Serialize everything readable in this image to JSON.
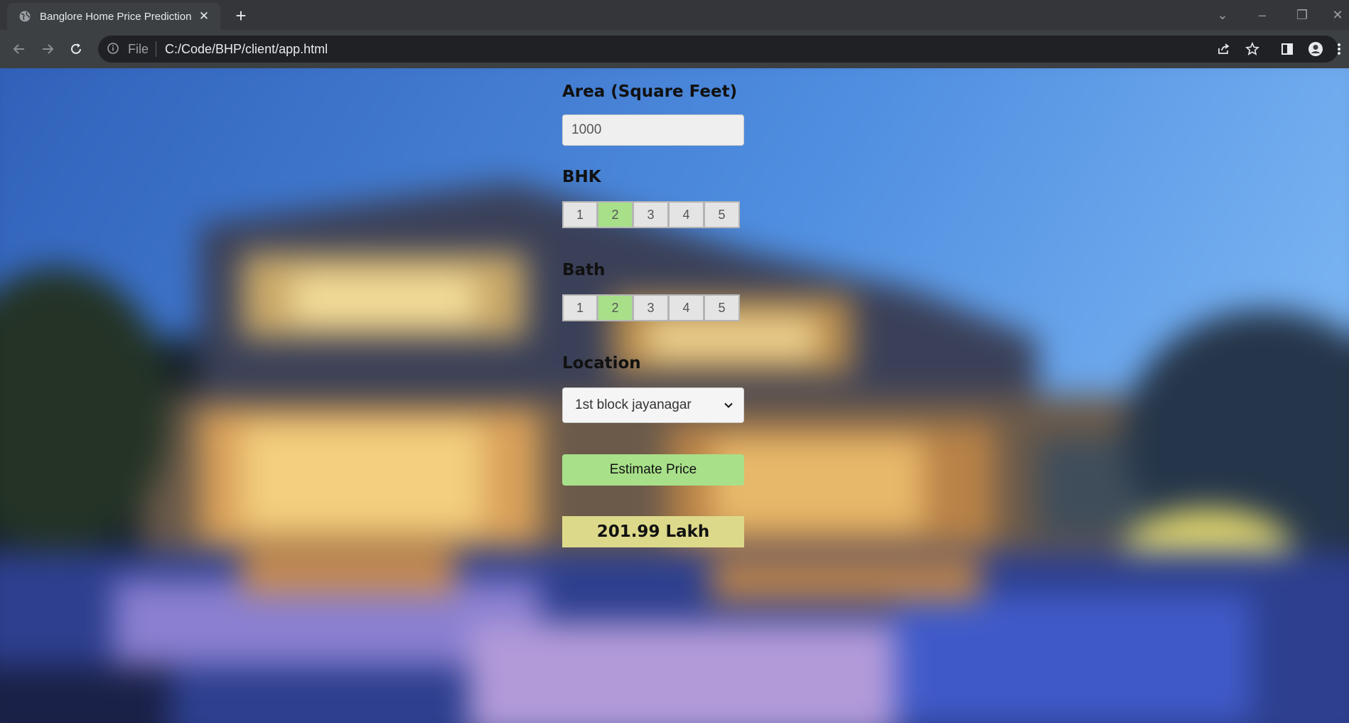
{
  "browser": {
    "tab_title": "Banglore Home Price Prediction",
    "address_scheme": "File",
    "address_url": "C:/Code/BHP/client/app.html"
  },
  "form": {
    "area": {
      "label": "Area (Square Feet)",
      "value": "1000"
    },
    "bhk": {
      "label": "BHK",
      "options": [
        "1",
        "2",
        "3",
        "4",
        "5"
      ],
      "selected": "2"
    },
    "bath": {
      "label": "Bath",
      "options": [
        "1",
        "2",
        "3",
        "4",
        "5"
      ],
      "selected": "2"
    },
    "location": {
      "label": "Location",
      "selected": "1st block jayanagar"
    },
    "estimate_button": "Estimate Price",
    "result": "201.99 Lakh"
  },
  "colors": {
    "selected_option": "#a8e08a",
    "button": "#a8e08a",
    "result_bg": "#ddd98a"
  }
}
